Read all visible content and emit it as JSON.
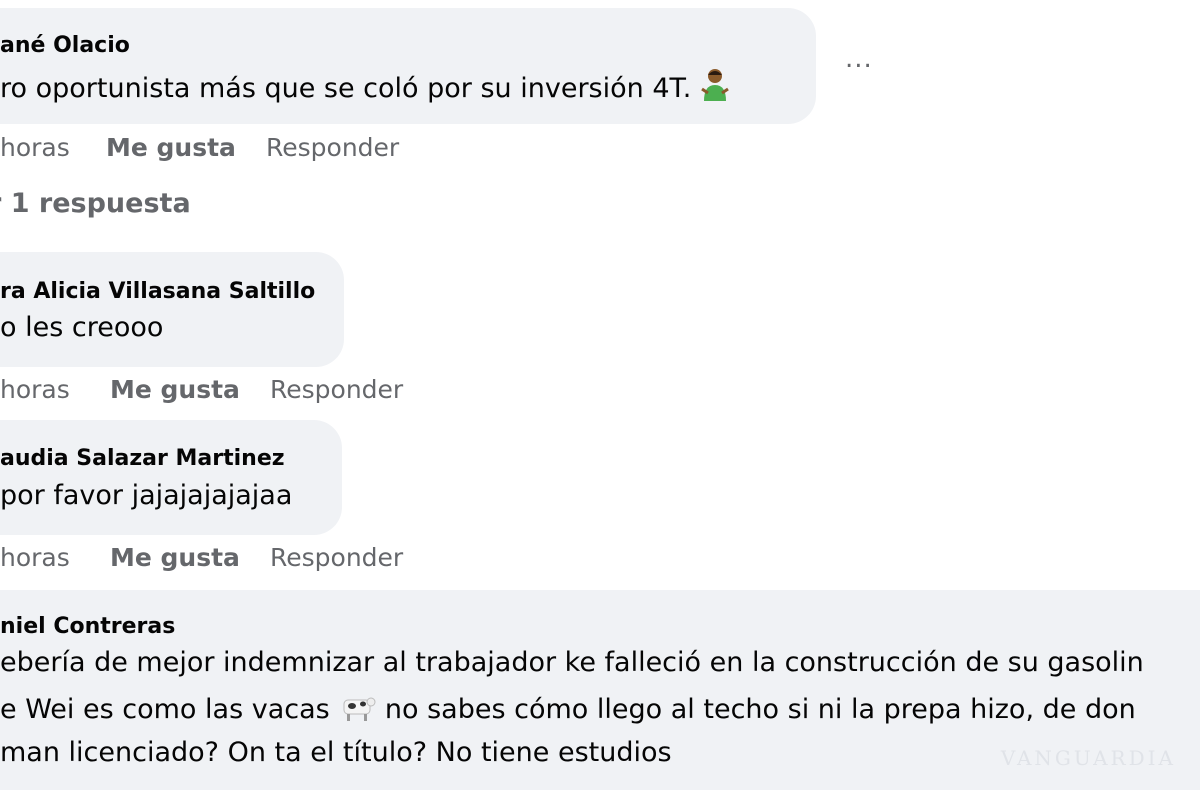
{
  "comments": [
    {
      "author": "ané Olacio",
      "text": "ro oportunista más que se coló por su inversión 4T.",
      "emoji": "person-shrugging-emoji",
      "time": "horas",
      "like": "Me gusta",
      "reply": "Responder"
    },
    {
      "author": "ra Alicia Villasana Saltillo",
      "text": "o les creooo",
      "time": "horas",
      "like": "Me gusta",
      "reply": "Responder"
    },
    {
      "author": "audia Salazar Martinez",
      "text": " por favor jajajajajajaa",
      "time": "horas",
      "like": "Me gusta",
      "reply": "Responder"
    },
    {
      "author": "niel Contreras",
      "lines": [
        "ebería de mejor indemnizar al trabajador ke falleció en la construcción de su gasolin",
        "e Wei es como las vacas",
        "no sabes cómo llego al techo si ni la prepa hizo, de don",
        "man licenciado? On ta el título? No tiene estudios"
      ],
      "emoji": "cow-emoji"
    }
  ],
  "more_options": "...",
  "replies_link": "r 1 respuesta",
  "watermark": "VANGUARDIA"
}
